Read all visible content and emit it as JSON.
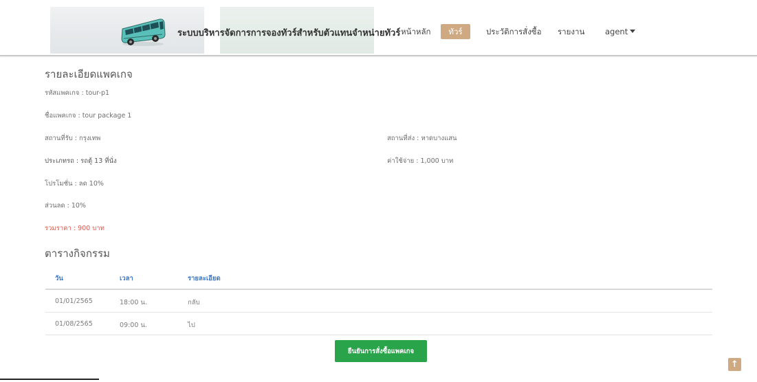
{
  "header": {
    "title": "ระบบบริหารจัดการการจองทัวร์สำหรับตัวแทนจำหน่ายทัวร์",
    "nav": {
      "home": "หน้าหลัก",
      "tour": "ทัวร์",
      "history": "ประวัติการสั่งซื้อ",
      "report": "รายงาน",
      "agent": "agent"
    },
    "logo_icon": "bus-icon",
    "accent_color": "#cfa981"
  },
  "detail": {
    "title": "รายละเอียดแพคเกจ",
    "code": "รหัสแพคเกจ : tour-p1",
    "name": "ชื่อแพคเกจ : tour package 1",
    "pickup": "สถานที่รับ : กรุงเทพ",
    "dropoff": "สถานที่ส่ง : หาดบางแสน",
    "vehicle": "ประเภทรถ : รถตู้ 13 ที่นั่ง",
    "cost": "ค่าใช้จ่าย : 1,000 บาท",
    "promotion": "โปรโมชั่น : ลด 10%",
    "discount": "ส่วนลด : 10%",
    "total": "รวมราคา : 900 บาท",
    "total_color": "#e2574c"
  },
  "schedule": {
    "title": "ตารางกิจกรรม",
    "columns": [
      "วัน",
      "เวลา",
      "รายละเอียด"
    ],
    "rows": [
      [
        "01/01/2565",
        "18:00 น.",
        "กลับ"
      ],
      [
        "01/08/2565",
        "09:00 น.",
        "ไป"
      ]
    ]
  },
  "actions": {
    "confirm": "ยืนยันการสั่งซื้อแพคเกจ",
    "confirm_color": "#2aa44a",
    "scroll_top": "↑"
  }
}
